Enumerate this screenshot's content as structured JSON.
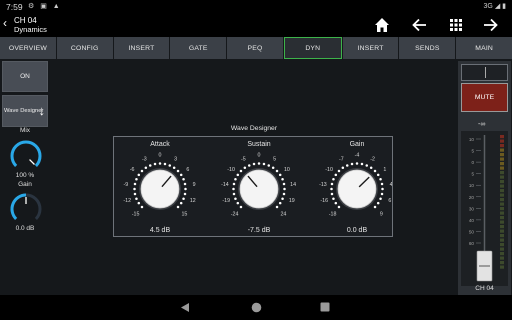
{
  "status_bar": {
    "time": "7:59",
    "icons": "⚙ ▣ ▲",
    "right": "3G ◢ ▮"
  },
  "header": {
    "back_glyph": "‹",
    "channel": "CH 04",
    "subtitle": "Dynamics",
    "icons": [
      "home-icon",
      "arrow-left-icon",
      "grid-icon",
      "arrow-right-icon"
    ]
  },
  "tabs": [
    {
      "label": "OVERVIEW",
      "active": false
    },
    {
      "label": "CONFIG",
      "active": false
    },
    {
      "label": "INSERT",
      "active": false
    },
    {
      "label": "GATE",
      "active": false
    },
    {
      "label": "PEQ",
      "active": false
    },
    {
      "label": "DYN",
      "active": true
    },
    {
      "label": "INSERT",
      "active": false
    },
    {
      "label": "SENDS",
      "active": false
    },
    {
      "label": "MAIN",
      "active": false
    }
  ],
  "left": {
    "on_label": "ON",
    "wave_designer_label": "Wave Designer",
    "mix_label": "Mix",
    "mix_value": "100 %",
    "mix_fraction": 1.0,
    "gain_label": "Gain",
    "gain_value": "0.0 dB",
    "gain_fraction": 0.5
  },
  "wave_designer": {
    "title": "Wave Designer",
    "knobs": [
      {
        "name": "Attack",
        "value": "4.5 dB",
        "fraction": 0.65,
        "left_ticks": [
          "-15",
          "-12",
          "-9",
          "-6",
          "-3"
        ],
        "top_tick": "0",
        "right_ticks": [
          "3",
          "6",
          "9",
          "12",
          "15"
        ]
      },
      {
        "name": "Sustain",
        "value": "-7.5 dB",
        "fraction": 0.35,
        "left_ticks": [
          "-24",
          "-19",
          "-14",
          "-10",
          "-5"
        ],
        "top_tick": "0",
        "right_ticks": [
          "5",
          "10",
          "14",
          "19",
          "24"
        ]
      },
      {
        "name": "Gain",
        "value": "0.0 dB",
        "fraction": 0.67,
        "left_ticks": [
          "-18",
          "-16",
          "-13",
          "-10",
          "-7"
        ],
        "top_tick": "-4",
        "right_ticks": [
          "-2",
          "1",
          "4",
          "6",
          "9"
        ]
      }
    ]
  },
  "meter": {
    "mute_label": "MUTE",
    "top_label": "-∞",
    "scale": [
      "10",
      "5",
      "0",
      "5",
      "10",
      "20",
      "30",
      "40",
      "50",
      "60"
    ],
    "fader_fraction": 0.0,
    "channel_label": "CH 04"
  },
  "nav": {
    "icons": [
      "back-triangle-icon",
      "home-circle-icon",
      "recents-square-icon"
    ]
  },
  "colors": {
    "accent_green": "#3db34a",
    "knob_blue": "#29a8e8",
    "mute_red": "#7d2119",
    "tab_bg": "#3b4047"
  }
}
